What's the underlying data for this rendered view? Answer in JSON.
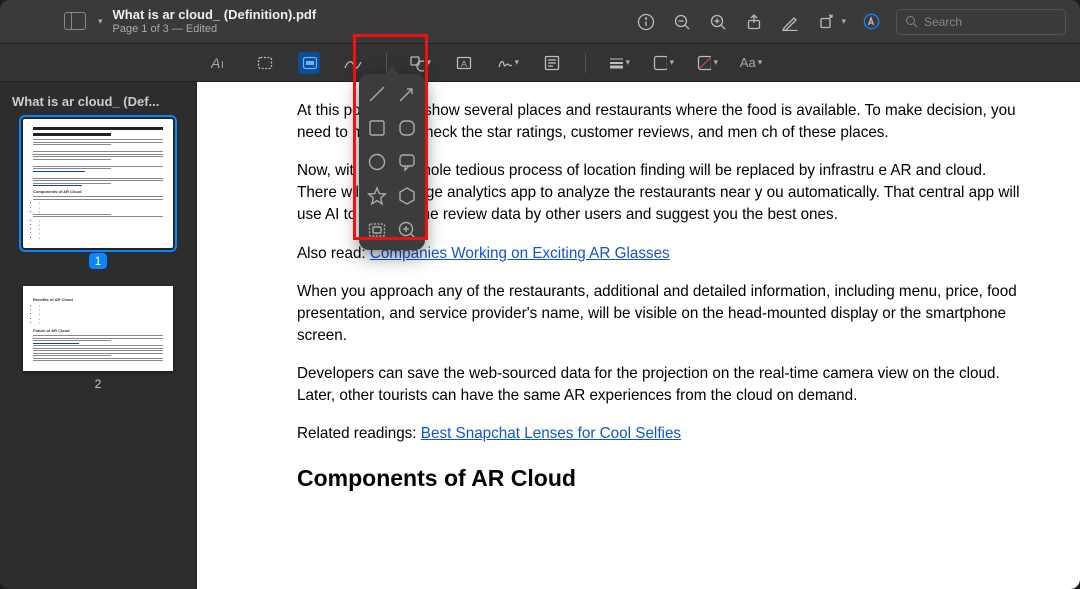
{
  "titlebar": {
    "filename": "What is ar cloud_ (Definition).pdf",
    "subtitle": "Page 1 of 3 — Edited",
    "search_placeholder": "Search"
  },
  "sidebar": {
    "title": "What is ar cloud_ (Def...",
    "pages": [
      {
        "number": "1",
        "selected": true
      },
      {
        "number": "2",
        "selected": false
      }
    ]
  },
  "content": {
    "p1a": "At this po",
    "p1b": "map will show several places and restaurants where the food is available. To make",
    "p1c": "decision, you need to manually check the star ratings, customer reviews, and men            ch of these places.",
    "p2a": "Now, wit",
    "p2b": "ud, this whole tedious process of location finding will be replaced by infrastru           e AR and cloud. There will be an edge analytics app to analyze the restaurants near y",
    "p2c": "ou automatically. That central app will use AI to analyze the review data by other users and suggest you the best ones.",
    "also_read_label": "Also read:",
    "link1": "Companies Working on Exciting AR Glasses",
    "p3": "When you approach any of the restaurants, additional and detailed information, including menu, price, food presentation, and service provider's name, will be visible on the head-mounted display or the smartphone screen.",
    "p4": "Developers can save the web-sourced data for the projection on the real-time camera view on the cloud. Later, other tourists can have the same AR experiences from the cloud on demand.",
    "related_label": "Related readings:",
    "link2": "Best Snapchat Lenses for Cool Selfies",
    "heading": "Components of AR Cloud"
  },
  "shape_popover_items": [
    "line",
    "arrow",
    "square",
    "rounded-square",
    "circle",
    "speech-bubble",
    "star",
    "hexagon",
    "mask",
    "loupe"
  ],
  "colors": {
    "accent": "#0a84ff",
    "highlight_box": "#e11"
  }
}
